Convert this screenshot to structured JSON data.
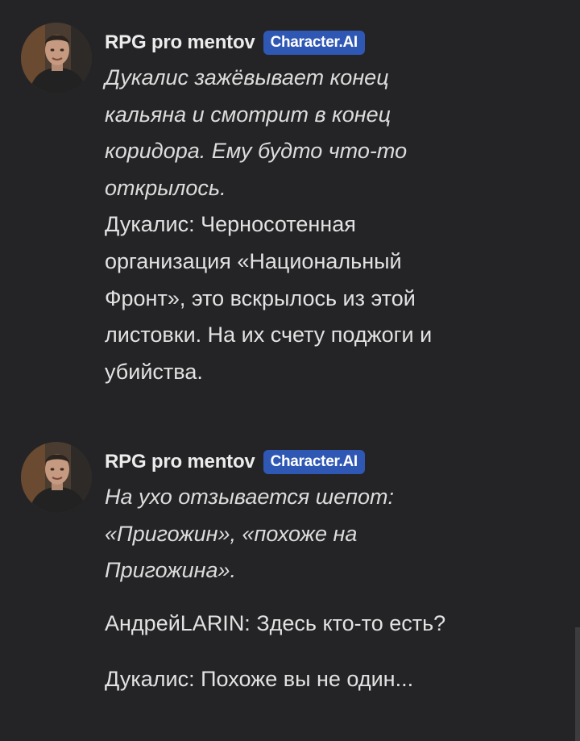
{
  "messages": [
    {
      "author": "RPG pro mentov",
      "badge": "Character.AI",
      "avatar": "avatar-photo",
      "paragraphs": [
        {
          "style": "italic",
          "text": "Дукалис зажёвывает конец\nкальяна и смотрит в конец\nкоридора. Ему будто что-то\nоткрылось."
        },
        {
          "style": "normal",
          "text": "Дукалис: Черносотенная\nорганизация «Национальный\nФронт», это вскрылось из этой\nлистовки. На их счету поджоги и\nубийства."
        }
      ]
    },
    {
      "author": "RPG pro mentov",
      "badge": "Character.AI",
      "avatar": "avatar-photo",
      "paragraphs": [
        {
          "style": "italic",
          "text": "На ухо отзывается шепот:\n«Пригожин», «похоже на\nПригожина»."
        },
        {
          "style": "normal",
          "text": "АндрейLARIN: Здесь кто-то есть?"
        },
        {
          "style": "normal",
          "text": "Дукалис: Похоже вы не один..."
        }
      ]
    }
  ],
  "colors": {
    "background": "#242426",
    "badge": "#2f57b4",
    "text": "#e2e2e2"
  }
}
